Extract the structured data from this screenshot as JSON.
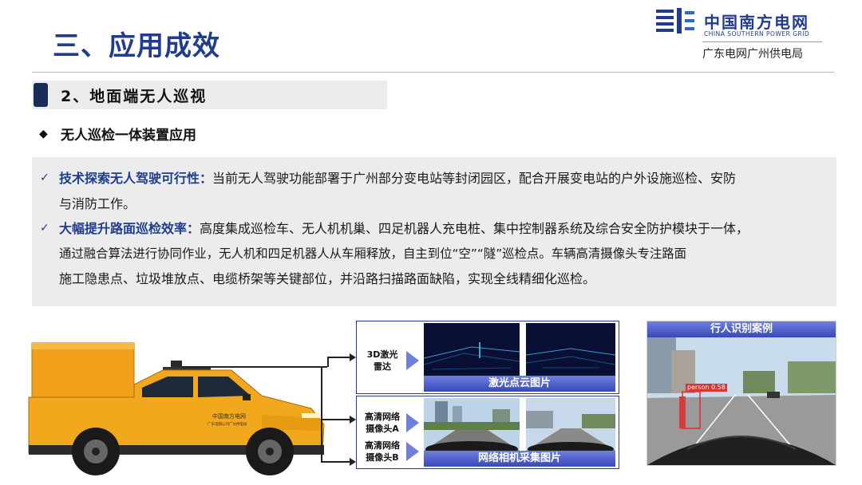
{
  "header": {
    "title": "三、应用成效",
    "logo_cn": "中国南方电网",
    "logo_en": "CHINA SOUTHERN POWER GRID",
    "org": "广东电网广州供电局"
  },
  "section": {
    "title": "2、地面端无人巡视",
    "bullet": "无人巡检一体装置应用"
  },
  "paragraphs": [
    {
      "keyword": "技术探索无人驾驶可行性：",
      "line1": "当前无人驾驶功能部署于广州部分变电站等封闭园区，配合开展变电站的户外设施巡检、安防",
      "line2": "与消防工作。"
    },
    {
      "keyword": "大幅提升路面巡检效率：",
      "line1": "高度集成巡检车、无人机机巢、四足机器人充电桩、集中控制器系统及综合安全防护模块于一体，",
      "line2": "通过融合算法进行协同作业，无人机和四足机器人从车厢释放，自主到位“空”“隧”巡检点。车辆高清摄像头专注路面",
      "line3": "施工隐患点、垃圾堆放点、电缆桥架等关键部位，并沿路扫描路面缺陷，实现全线精细化巡检。"
    }
  ],
  "vehicle_logo": "中国南方电网",
  "vehicle_logo_sub": "广东电网公司广州供电局",
  "sensors": {
    "lidar_1": "3D激光",
    "lidar_2": "雷达",
    "camA_1": "高清网络",
    "camA_2": "摄像头A",
    "camB_1": "高清网络",
    "camB_2": "摄像头B"
  },
  "captions": {
    "lidar": "激光点云图片",
    "camera": "网络相机采集图片",
    "pedestrian": "行人识别案例"
  },
  "detection_label": "person 0.58",
  "colors": {
    "brand_blue": "#1f3d8c",
    "panel_blue": "#2a3a9a",
    "vehicle_yellow": "#f2a81d"
  }
}
